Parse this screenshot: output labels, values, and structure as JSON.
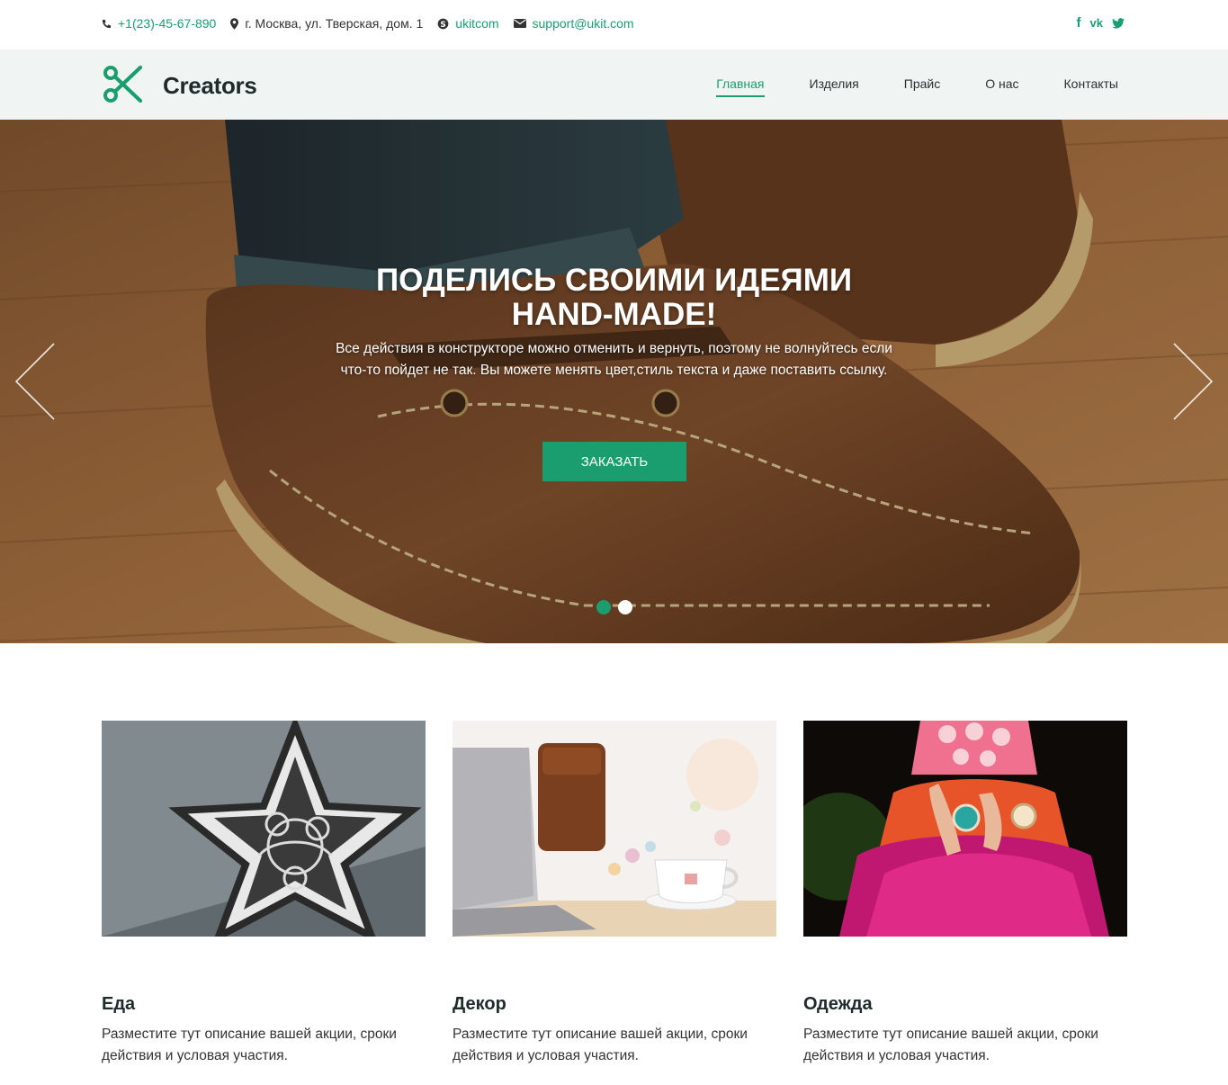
{
  "topbar": {
    "phone": "+1(23)-45-67-890",
    "address": "г. Москва, ул. Тверская, дом. 1",
    "skype": "ukitcom",
    "email": "support@ukit.com",
    "socials": [
      "f",
      "vk",
      "twitter"
    ]
  },
  "header": {
    "logo_text": "Creators",
    "nav": [
      "Главная",
      "Изделия",
      "Прайс",
      "О нас",
      "Контакты"
    ],
    "active_nav": "Главная"
  },
  "hero": {
    "title_line1": "ПОДЕЛИСЬ СВОИМИ ИДЕЯМИ",
    "title_line2": "HAND-MADE!",
    "text": "Все действия в конструкторе можно отменить и вернуть, поэтому не волнуйтесь если что-то пойдет не так. Вы можете менять цвет,стиль текста и даже поставить ссылку.",
    "button": "ЗАКАЗАТЬ",
    "slides": 2,
    "active_slide": 1
  },
  "cards": [
    {
      "title": "Еда",
      "text": "Разместите тут описание вашей акции, сроки действия и условая участия."
    },
    {
      "title": "Декор",
      "text": "Разместите тут описание вашей акции, сроки действия и условая участия."
    },
    {
      "title": "Одежда",
      "text": "Разместите тут описание вашей акции, сроки действия и условая участия."
    }
  ],
  "colors": {
    "accent": "#1a9e6f",
    "header_bg": "#f0f5f3"
  },
  "icons": [
    "phone-icon",
    "map-pin-icon",
    "skype-icon",
    "mail-icon",
    "facebook-icon",
    "vk-icon",
    "twitter-icon",
    "scissors-logo-icon",
    "chevron-left-icon",
    "chevron-right-icon"
  ]
}
